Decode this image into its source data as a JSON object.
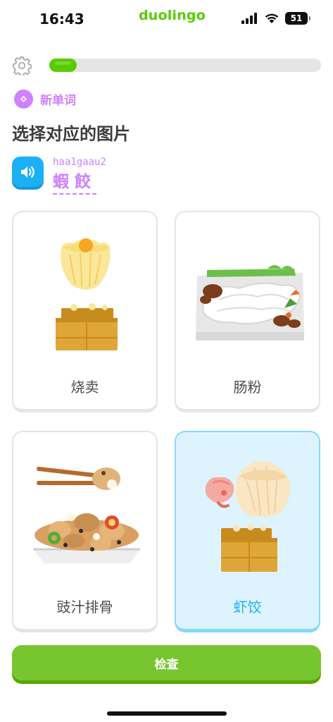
{
  "status_bar": {
    "time": "16:43",
    "battery": "51",
    "icons": [
      "signal-icon",
      "wifi-icon",
      "battery-icon"
    ]
  },
  "app": {
    "brand": "duolingo",
    "accent": "#58cc02",
    "purple": "#ce82ff",
    "blue": "#1cb0f6"
  },
  "lesson": {
    "progress": 0.1,
    "tag_label": "新单词",
    "prompt": "选择对应的图片",
    "romanization": "haa1gaau2",
    "word": "蝦餃"
  },
  "choices": [
    {
      "label": "烧卖",
      "icon": "siu-mai-icon",
      "selected": false
    },
    {
      "label": "肠粉",
      "icon": "rice-noodle-roll-icon",
      "selected": false
    },
    {
      "label": "豉汁排骨",
      "icon": "spare-ribs-icon",
      "selected": false
    },
    {
      "label": "虾饺",
      "icon": "har-gow-icon",
      "selected": true
    }
  ],
  "footer": {
    "check_label": "检查"
  }
}
